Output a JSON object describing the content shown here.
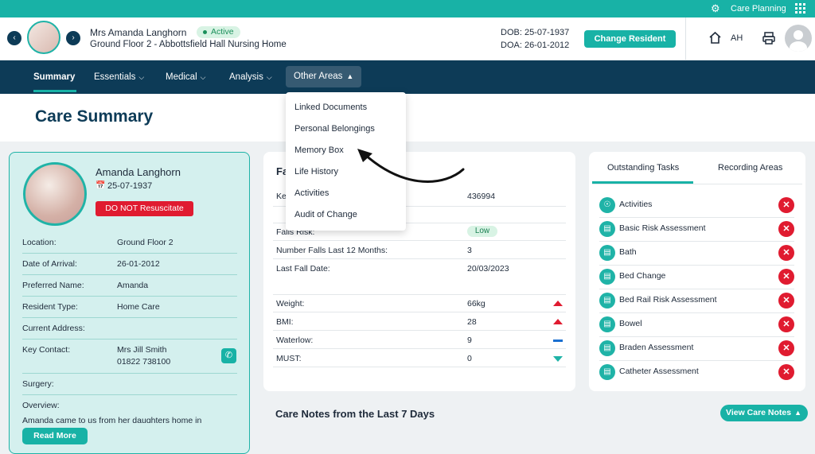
{
  "topbar": {
    "app_label": "Care Planning"
  },
  "header": {
    "resident_name": "Mrs Amanda Langhorn",
    "status": "Active",
    "location_line": "Ground Floor 2 - Abbottsfield Hall Nursing Home",
    "dob": "DOB: 25-07-1937",
    "doa": "DOA: 26-01-2012",
    "change_resident": "Change Resident",
    "user_initials": "AH"
  },
  "nav": {
    "items": [
      {
        "label": "Summary"
      },
      {
        "label": "Essentials"
      },
      {
        "label": "Medical"
      },
      {
        "label": "Analysis"
      },
      {
        "label": "Other Areas"
      }
    ],
    "dropdown": [
      "Linked Documents",
      "Personal Belongings",
      "Memory Box",
      "Life History",
      "Activities",
      "Audit of Change"
    ]
  },
  "page_title": "Care Summary",
  "profile": {
    "name": "Amanda Langhorn",
    "dob": "25-07-1937",
    "dnr": "DO NOT Resuscitate",
    "rows": [
      {
        "label": "Location:",
        "value": "Ground Floor 2"
      },
      {
        "label": "Date of Arrival:",
        "value": "26-01-2012"
      },
      {
        "label": "Preferred Name:",
        "value": "Amanda"
      },
      {
        "label": "Resident Type:",
        "value": "Home Care"
      },
      {
        "label": "Current Address:",
        "value": ""
      },
      {
        "label": "Key Contact:",
        "value": "Mrs Jill Smith",
        "value2": "01822 738100"
      },
      {
        "label": "Surgery:",
        "value": ""
      },
      {
        "label": "Overview:",
        "value": ""
      }
    ],
    "overview_text": "Amanda came to us from her daughters home in",
    "read_more": "Read More"
  },
  "middle": {
    "title_partial": "Fa",
    "key_partial": "Ke",
    "key_value": "436994",
    "rows": [
      {
        "label": "Falls Risk:",
        "value": "Low"
      },
      {
        "label": "Number Falls Last 12 Months:",
        "value": "3"
      },
      {
        "label": "Last Fall Date:",
        "value": "20/03/2023"
      }
    ],
    "measures": [
      {
        "label": "Weight:",
        "value": "66kg",
        "trend": "up"
      },
      {
        "label": "BMI:",
        "value": "28",
        "trend": "up"
      },
      {
        "label": "Waterlow:",
        "value": "9",
        "trend": "flat"
      },
      {
        "label": "MUST:",
        "value": "0",
        "trend": "down"
      }
    ]
  },
  "care_notes": {
    "title": "Care Notes from the Last 7 Days",
    "button": "View Care Notes"
  },
  "tasks": {
    "tab_active": "Outstanding Tasks",
    "tab_other": "Recording Areas",
    "items": [
      "Activities",
      "Basic Risk Assessment",
      "Bath",
      "Bed Change",
      "Bed Rail Risk Assessment",
      "Bowel",
      "Braden Assessment",
      "Catheter Assessment"
    ]
  }
}
